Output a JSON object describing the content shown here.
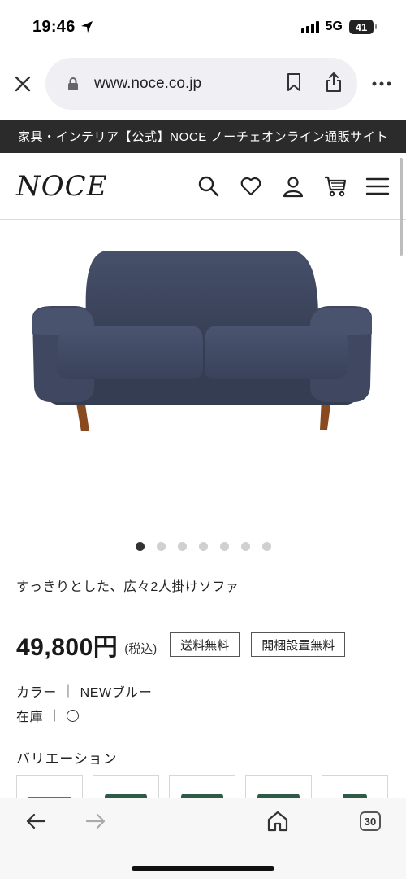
{
  "status_bar": {
    "time": "19:46",
    "network": "5G",
    "battery": "41"
  },
  "browser": {
    "url": "www.noce.co.jp",
    "icons": [
      "close-icon",
      "lock-icon",
      "bookmark-icon",
      "share-icon",
      "more-icon"
    ]
  },
  "site": {
    "banner": "家具・インテリア【公式】NOCE ノーチェオンライン通販サイト",
    "logo": "NOCE",
    "header_icons": [
      "search-icon",
      "heart-icon",
      "user-icon",
      "cart-icon",
      "menu-icon"
    ]
  },
  "product": {
    "image_alt": "sofa-image",
    "carousel": {
      "count": 7,
      "active": 1
    },
    "title": "すっきりとした、広々2人掛けソファ",
    "price": "49,800円",
    "tax_label": "(税込)",
    "badges": [
      "送料無料",
      "開梱設置無料"
    ],
    "color_label": "カラー",
    "color_value": "NEWブルー",
    "stock_label": "在庫",
    "variation_title": "バリエーション",
    "variation_swatches": [
      "#6a6a6a",
      "#2f5a48",
      "#2f5a48",
      "#2f5a48",
      "#2f5a48"
    ]
  },
  "toolbar": {
    "icons": [
      "back-icon",
      "forward-icon",
      "home-icon",
      "tabs-icon"
    ],
    "tabs_count": "30"
  },
  "colors": {
    "banner_bg": "#2b2b2b",
    "sofa": "#3b4356",
    "sofa_legs": "#8a4a1f"
  }
}
